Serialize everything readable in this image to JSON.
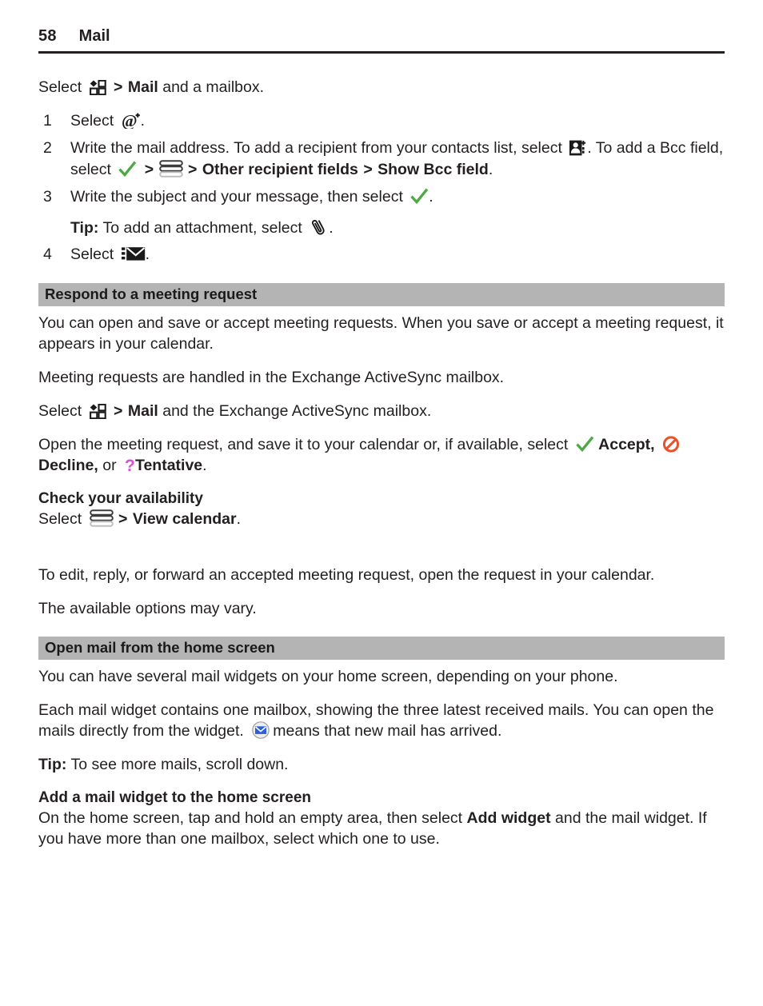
{
  "header": {
    "page_number": "58",
    "chapter": "Mail"
  },
  "intro": {
    "select_word": "Select",
    "menu_icon": "apps-grid-icon",
    "separator": ">",
    "bold_mail": "Mail",
    "rest": "and a mailbox."
  },
  "steps": [
    {
      "num": "1",
      "pre": "Select",
      "icon": "new-mail-at-plus-icon",
      "post": "."
    },
    {
      "num": "2",
      "pre": "Write the mail address. To add a recipient from your contacts list, select",
      "icon": "add-contact-icon",
      "mid1": ". To add a Bcc field, select",
      "icon2": "green-check-icon",
      "gt1": ">",
      "icon3": "options-stack-icon",
      "gt2": ">",
      "bold1": "Other recipient fields",
      "gt3": ">",
      "bold2": "Show Bcc field",
      "post": "."
    },
    {
      "num": "3",
      "pre": "Write the subject and your message, then select",
      "icon": "green-check-icon",
      "post": "."
    }
  ],
  "tip_attachment": {
    "label": "Tip:",
    "text": "To add an attachment, select",
    "icon": "paperclip-icon",
    "post": "."
  },
  "step4": {
    "num": "4",
    "pre": "Select",
    "icon": "send-mail-icon",
    "post": "."
  },
  "section_meeting": {
    "heading": "Respond to a meeting request",
    "para1": "You can open and save or accept meeting requests. When you save or accept a meeting request, it appears in your calendar.",
    "para2": "Meeting requests are handled in the Exchange ActiveSync mailbox.",
    "select_line": {
      "pre": "Select",
      "icon": "apps-grid-icon",
      "gt": ">",
      "bold": "Mail",
      "post": "and the Exchange ActiveSync mailbox."
    },
    "open_line": {
      "pre": "Open the meeting request, and save it to your calendar or, if available, select",
      "icon_accept": "green-check-icon",
      "bold_accept": "Accept,",
      "icon_decline": "decline-no-entry-icon",
      "bold_decline": "Decline,",
      "or_word": "or",
      "icon_tentative": "tentative-question-icon",
      "bold_tentative": "Tentative",
      "post": "."
    },
    "availability": {
      "heading": "Check your availability",
      "pre": "Select",
      "icon": "options-stack-icon",
      "gt": ">",
      "bold": "View calendar",
      "post": "."
    },
    "para3": "To edit, reply, or forward an accepted meeting request, open the request in your calendar.",
    "para4": "The available options may vary."
  },
  "section_home": {
    "heading": "Open mail from the home screen",
    "para1": "You can have several mail widgets on your home screen, depending on your phone.",
    "para2_a": "Each mail widget contains one mailbox, showing the three latest received mails. You can open the mails directly from the widget.",
    "para2_icon": "new-mail-arrived-icon",
    "para2_b": "means that new mail has arrived.",
    "tip": {
      "label": "Tip:",
      "text": "To see more mails, scroll down."
    },
    "add_widget": {
      "heading": "Add a mail widget to the home screen",
      "pre": "On the home screen, tap and hold an empty area, then select",
      "bold": "Add widget",
      "post": "and the mail widget. If you have more than one mailbox, select which one to use."
    }
  },
  "colors": {
    "section_bar": "#b4b4b4",
    "check_green": "#4fa846",
    "decline_red": "#e8512c",
    "tentative_magenta": "#d74fd7",
    "mail_blue": "#2b5fd9",
    "text": "#231f20"
  }
}
